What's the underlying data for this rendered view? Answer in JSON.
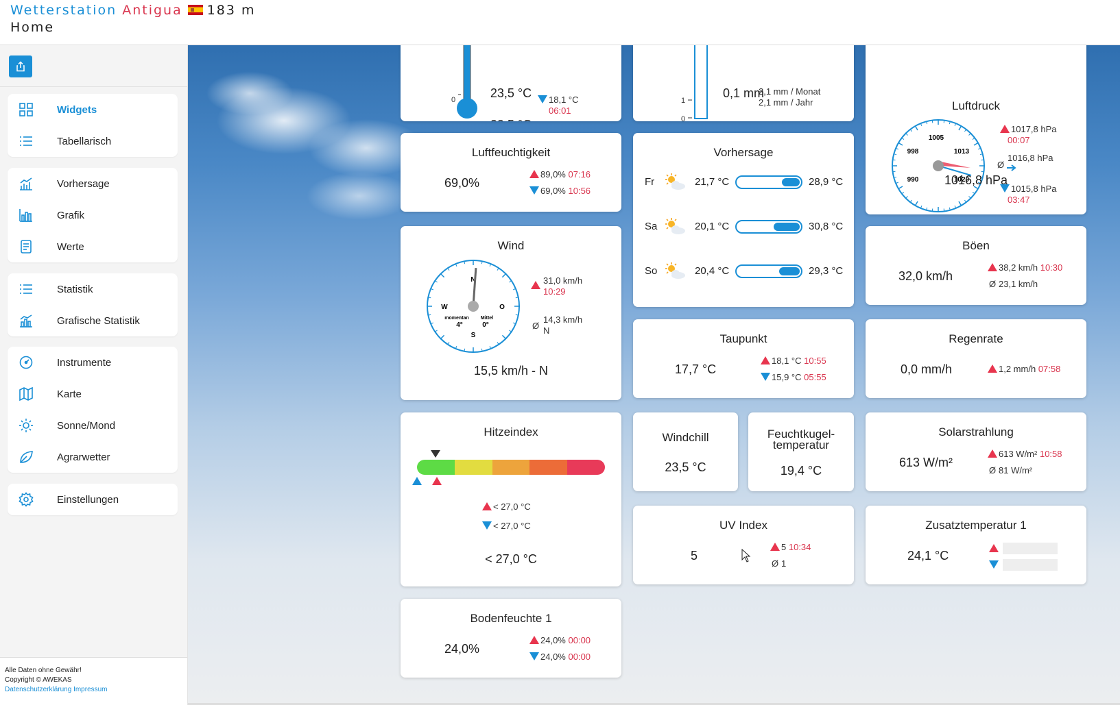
{
  "header": {
    "station_prefix": "Wetterstation",
    "station_name": "Antigua",
    "altitude": "183 m",
    "page": "Home"
  },
  "sidebar": {
    "groups": [
      [
        {
          "label": "Widgets",
          "icon": "widgets-grid-icon",
          "active": true
        },
        {
          "label": "Tabellarisch",
          "icon": "list-icon"
        }
      ],
      [
        {
          "label": "Vorhersage",
          "icon": "forecast-chart-icon"
        },
        {
          "label": "Grafik",
          "icon": "bar-chart-icon"
        },
        {
          "label": "Werte",
          "icon": "document-icon"
        }
      ],
      [
        {
          "label": "Statistik",
          "icon": "list-icon"
        },
        {
          "label": "Grafische Statistik",
          "icon": "stats-chart-icon"
        }
      ],
      [
        {
          "label": "Instrumente",
          "icon": "gauge-icon"
        },
        {
          "label": "Karte",
          "icon": "map-icon"
        },
        {
          "label": "Sonne/Mond",
          "icon": "sun-icon"
        },
        {
          "label": "Agrarwetter",
          "icon": "leaf-icon"
        }
      ],
      [
        {
          "label": "Einstellungen",
          "icon": "gear-icon"
        }
      ]
    ],
    "footer": {
      "disclaimer": "Alle Daten ohne Gewähr!",
      "copyright": "Copyright © AWEKAS",
      "privacy": "Datenschutzerklärung",
      "imprint": "Impressum"
    }
  },
  "widgets": {
    "temperature": {
      "value": "23,5 °C",
      "min_value": "18,1 °C",
      "min_time": "06:01",
      "scale_zero": "0"
    },
    "rain": {
      "value": "0,1 mm",
      "month": "2,1 mm / Monat",
      "year": "2,1 mm / Jahr",
      "scale_one": "1",
      "scale_zero": "0"
    },
    "pressure": {
      "title": "Luftdruck",
      "value": "1016,8 hPa",
      "max_value": "1017,8 hPa",
      "max_time": "00:07",
      "avg_value": "1016,8 hPa",
      "min_value": "1015,8 hPa",
      "min_time": "03:47",
      "ticks": [
        "990",
        "998",
        "1005",
        "1013",
        "1020"
      ],
      "avg_symbol": "Ø",
      "needle_value": 1016.8,
      "scale_min": 990,
      "scale_max": 1020
    },
    "humidity": {
      "title": "Luftfeuchtigkeit",
      "value": "69,0%",
      "max_value": "89,0%",
      "max_time": "07:16",
      "min_value": "69,0%",
      "min_time": "10:56"
    },
    "forecast": {
      "title": "Vorhersage",
      "days": [
        {
          "day": "Fr",
          "min": "21,7 °C",
          "max": "28,9 °C",
          "fill": 0.28,
          "icon": "sun-cloud-icon"
        },
        {
          "day": "Sa",
          "min": "20,1 °C",
          "max": "30,8 °C",
          "fill": 0.4,
          "icon": "sun-cloud-icon"
        },
        {
          "day": "So",
          "min": "20,4 °C",
          "max": "29,3 °C",
          "fill": 0.32,
          "icon": "sun-cloud-icon"
        }
      ]
    },
    "wind": {
      "title": "Wind",
      "value": "15,5 km/h - N",
      "max_value": "31,0 km/h",
      "max_time": "10:29",
      "avg_value": "14,3 km/h",
      "avg_dir": "N",
      "avg_symbol": "Ø",
      "compass": {
        "n": "N",
        "s": "S",
        "w": "W",
        "o": "O",
        "momentan_label": "momentan",
        "mittel_label": "Mittel",
        "momentan": "4°",
        "mittel": "0°",
        "direction_deg": 4
      }
    },
    "gust": {
      "title": "Böen",
      "value": "32,0 km/h",
      "max_value": "38,2 km/h",
      "max_time": "10:30",
      "avg_value": "23,1 km/h",
      "avg_symbol": "Ø"
    },
    "dewpoint": {
      "title": "Taupunkt",
      "value": "17,7 °C",
      "max_value": "18,1 °C",
      "max_time": "10:55",
      "min_value": "15,9 °C",
      "min_time": "05:55"
    },
    "rainrate": {
      "title": "Regenrate",
      "value": "0,0 mm/h",
      "max_value": "1,2 mm/h",
      "max_time": "07:58"
    },
    "heatindex": {
      "title": "Hitzeindex",
      "value": "< 27,0 °C",
      "max_value": "< 27,0 °C",
      "min_value": "< 27,0 °C",
      "colors": [
        "#5ddb45",
        "#e2dc40",
        "#eda43c",
        "#ec6c38",
        "#e83a59"
      ],
      "marker_level": 0.1
    },
    "windchill": {
      "title": "Windchill",
      "value": "23,5 °C"
    },
    "wetbulb": {
      "title_line1": "Feuchtkugel-",
      "title_line2": "temperatur",
      "value": "19,4 °C"
    },
    "solar": {
      "title": "Solarstrahlung",
      "value": "613 W/m²",
      "max_value": "613 W/m²",
      "max_time": "10:58",
      "avg_value": "81 W/m²",
      "avg_symbol": "Ø"
    },
    "uv": {
      "title": "UV Index",
      "value": "5",
      "max_value": "5",
      "max_time": "10:34",
      "avg_value": "1",
      "avg_symbol": "Ø"
    },
    "extratemp": {
      "title": "Zusatztemperatur 1",
      "value": "24,1 °C"
    },
    "soil": {
      "title": "Bodenfeuchte 1",
      "value": "24,0%",
      "max_value": "24,0%",
      "max_time": "00:00",
      "min_value": "24,0%",
      "min_time": "00:00"
    }
  }
}
